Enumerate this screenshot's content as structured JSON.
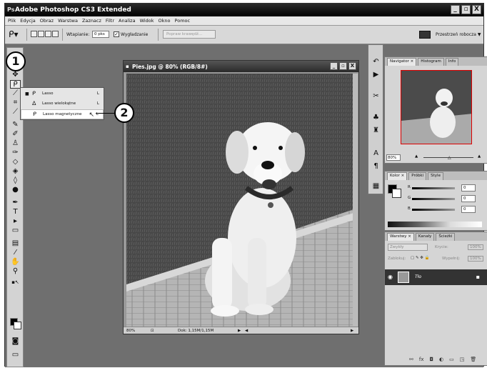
{
  "app": {
    "logo": "Ps",
    "title": "Adobe Photoshop CS3 Extended",
    "window_buttons": [
      "_",
      "▫",
      "X"
    ]
  },
  "menu": [
    "Plik",
    "Edycja",
    "Obraz",
    "Warstwa",
    "Zaznacz",
    "Filtr",
    "Analiza",
    "Widok",
    "Okno",
    "Pomoc"
  ],
  "options": {
    "feather_label": "Wtapianie:",
    "feather_value": "0 pks",
    "antialias_label": "Wygładzanie",
    "antialias_checked": true,
    "refine_button": "Popraw krawędź...",
    "workspace_button": "Przestrzeń robocza ▼"
  },
  "callouts": [
    "1",
    "2"
  ],
  "flyout": {
    "items": [
      {
        "label": "Lasso",
        "key": "L",
        "icon": "lasso-icon",
        "bullet": "■"
      },
      {
        "label": "Lasso wielokątne",
        "key": "L",
        "icon": "polygonal-lasso-icon",
        "bullet": ""
      },
      {
        "label": "Lasso magnetyczne",
        "key": "L",
        "icon": "magnetic-lasso-icon",
        "bullet": ""
      }
    ]
  },
  "document": {
    "title": "Pies.jpg @ 80% (RGB/8#)",
    "zoom": "80%",
    "doc_size": "Dok: 1,15M/1,15M"
  },
  "navigator": {
    "tabs": [
      "Navigator ×",
      "Histogram",
      "Info"
    ],
    "zoom": "80%"
  },
  "color_panel": {
    "tabs": [
      "Kolor ×",
      "Próbki",
      "Style"
    ],
    "rows": [
      {
        "label": "R",
        "value": "0"
      },
      {
        "label": "G",
        "value": "0"
      },
      {
        "label": "B",
        "value": "0"
      }
    ]
  },
  "layers_panel": {
    "tabs": [
      "Warstwy ×",
      "Kanały",
      "Ścieżki"
    ],
    "blend_mode": "Zwykły",
    "opacity_label": "Krycie:",
    "opacity_value": "100%",
    "lock_label": "Zablokuj:",
    "fill_label": "Wypełnij:",
    "fill_value": "100%",
    "layer_name": "Tło"
  },
  "colors": {
    "title_bar": "#000000",
    "menu_bg": "#e7e7e7",
    "workspace": "#6f6f6f",
    "panel_bg": "#d5d5d5",
    "selected_layer": "#333333"
  }
}
